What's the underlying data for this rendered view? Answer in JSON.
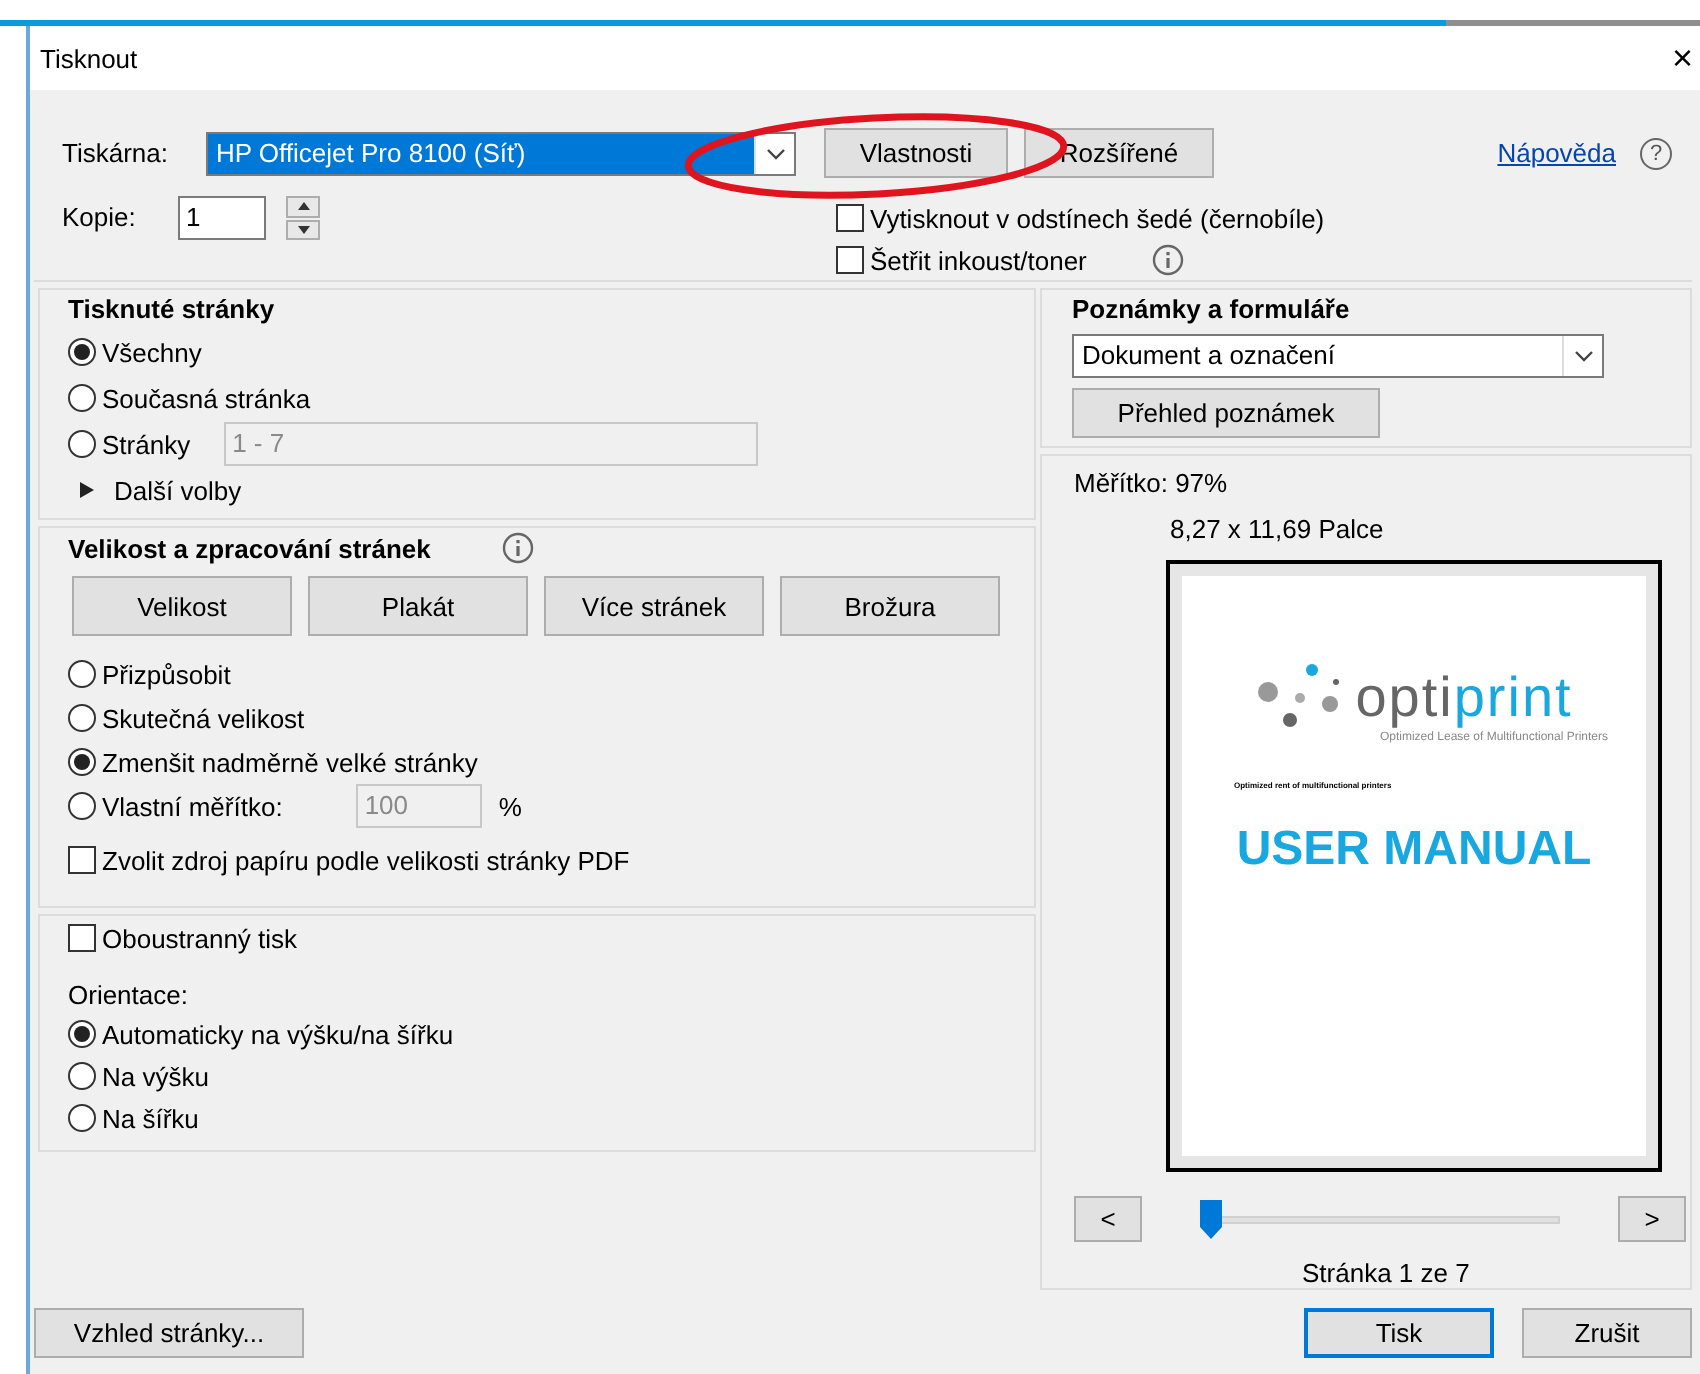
{
  "window": {
    "title": "Tisknout",
    "close": "×"
  },
  "printer": {
    "label": "Tiskárna:",
    "value": "HP Officejet Pro 8100 (Síť)"
  },
  "top_buttons": [
    {
      "label": "Vlastnosti"
    },
    {
      "label": "Rozšířené"
    }
  ],
  "help": {
    "link": "Nápověda",
    "mark": "?"
  },
  "copies": {
    "label": "Kopie:",
    "value": "1"
  },
  "top_options": [
    {
      "label": "Vytisknout v odstínech šedé (černobíle)",
      "checked": false,
      "info": false
    },
    {
      "label": "Šetřit inkoust/toner",
      "checked": false,
      "info": true
    }
  ],
  "pages_section": {
    "title": "Tisknuté stránky",
    "options": [
      {
        "label": "Všechny",
        "selected": true
      },
      {
        "label": "Současná stránka",
        "selected": false
      },
      {
        "label": "Stránky",
        "selected": false,
        "field": {
          "value": "1 - 7",
          "disabled": true
        }
      }
    ],
    "more": {
      "label": "Další volby",
      "expanded": false
    }
  },
  "size_section": {
    "title": "Velikost a zpracování stránek",
    "modes": [
      "Velikost",
      "Plakát",
      "Více stránek",
      "Brožura"
    ],
    "options": [
      {
        "label": "Přizpůsobit",
        "selected": false
      },
      {
        "label": "Skutečná velikost",
        "selected": false
      },
      {
        "label": "Zmenšit nadměrně velké stránky",
        "selected": true
      },
      {
        "label": "Vlastní měřítko:",
        "selected": false,
        "field": {
          "value": "100",
          "disabled": true
        },
        "unit": "%"
      }
    ],
    "paper_source": {
      "label": "Zvolit zdroj papíru podle velikosti stránky PDF",
      "checked": false
    }
  },
  "duplex": {
    "label": "Oboustranný tisk",
    "checked": false
  },
  "orientation": {
    "title": "Orientace:",
    "options": [
      {
        "label": "Automaticky na výšku/na šířku",
        "selected": true
      },
      {
        "label": "Na výšku",
        "selected": false
      },
      {
        "label": "Na šířku",
        "selected": false
      }
    ]
  },
  "comments": {
    "title": "Poznámky a formuláře",
    "value": "Dokument a označení",
    "button": "Přehled poznámek"
  },
  "preview": {
    "scale": "Měřítko:  97%",
    "size": "8,27 x 11,69 Palce",
    "document": {
      "logo_light": "opti",
      "logo_accent": "print",
      "tagline": "Optimized Lease of Multifunctional Printers",
      "note": "Optimized rent of multifunctional printers",
      "title": "USER MANUAL"
    },
    "prev": "<",
    "next": ">",
    "slider": {
      "level": 0
    },
    "page": "Stránka 1 ze 7"
  },
  "footer": {
    "setup": "Vzhled stránky...",
    "print": "Tisk",
    "cancel": "Zrušit"
  }
}
